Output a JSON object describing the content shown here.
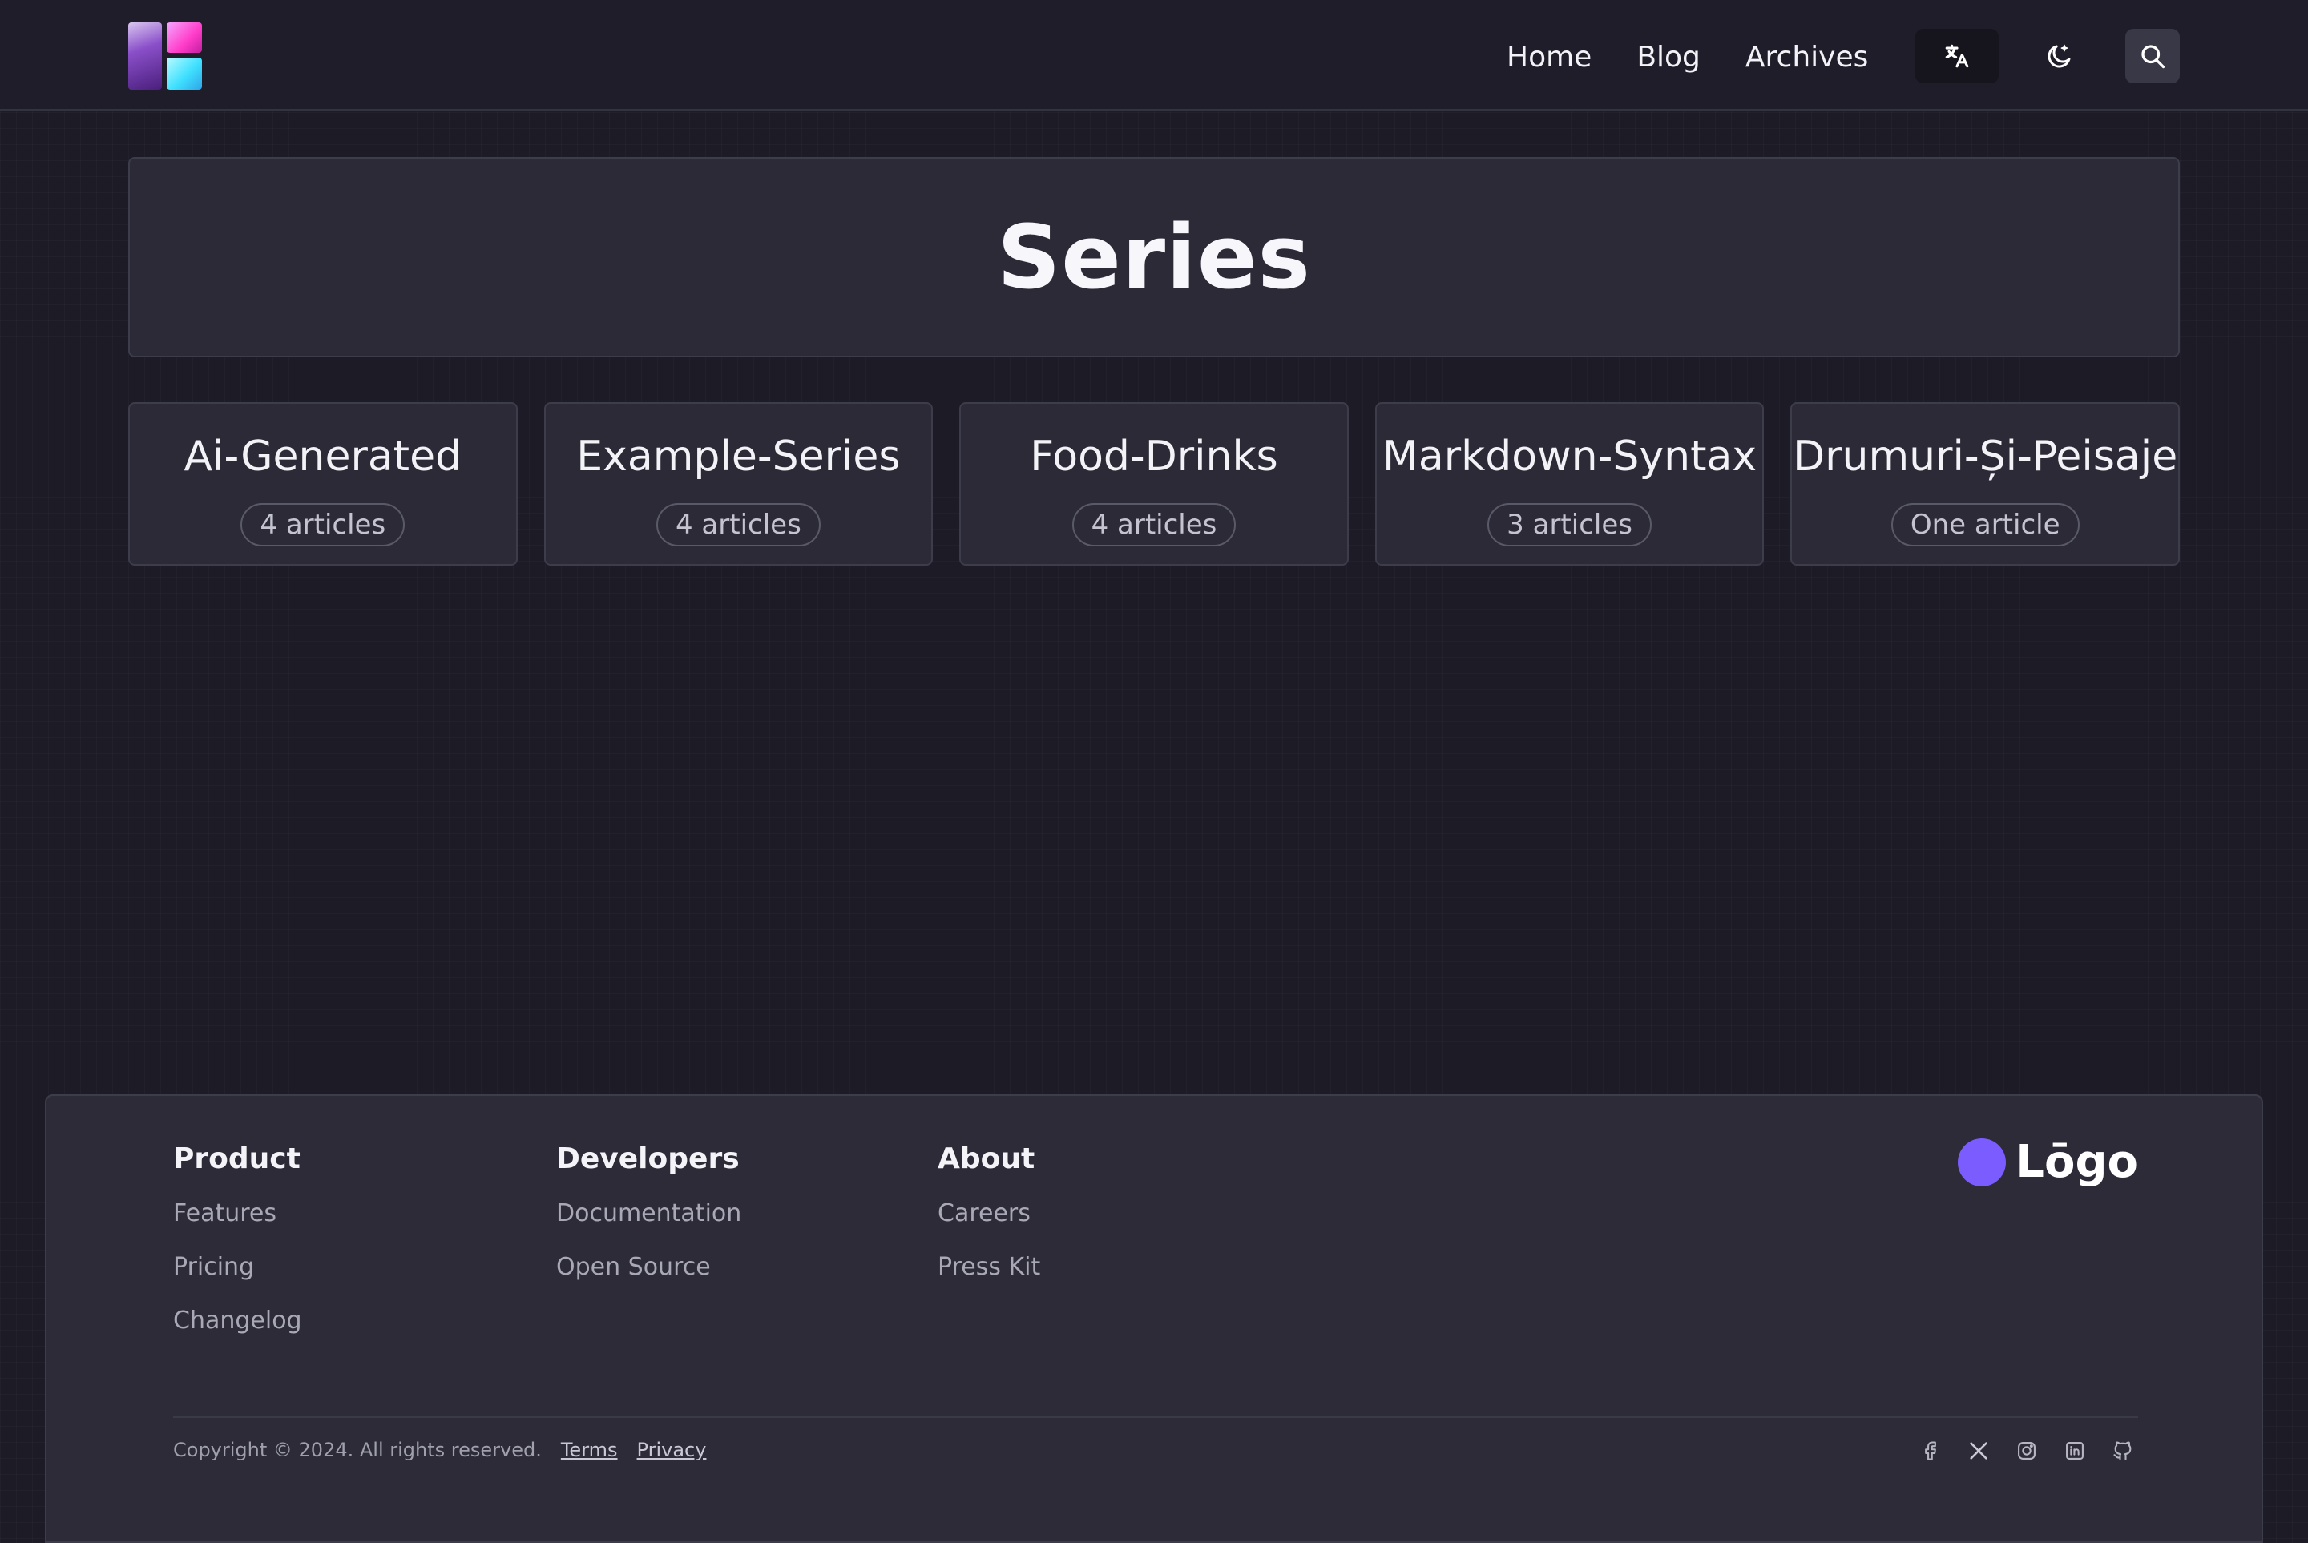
{
  "header": {
    "nav": [
      "Home",
      "Blog",
      "Archives"
    ],
    "icons": {
      "translate": "translate-icon",
      "theme": "moon-icon",
      "search": "search-icon"
    }
  },
  "hero": {
    "title": "Series"
  },
  "series": [
    {
      "name": "Ai-Generated",
      "count": "4 articles"
    },
    {
      "name": "Example-Series",
      "count": "4 articles"
    },
    {
      "name": "Food-Drinks",
      "count": "4 articles"
    },
    {
      "name": "Markdown-Syntax",
      "count": "3 articles"
    },
    {
      "name": "Drumuri-Și-Peisaje",
      "count": "One article"
    }
  ],
  "footer": {
    "columns": [
      {
        "title": "Product",
        "links": [
          "Features",
          "Pricing",
          "Changelog"
        ]
      },
      {
        "title": "Developers",
        "links": [
          "Documentation",
          "Open Source"
        ]
      },
      {
        "title": "About",
        "links": [
          "Careers",
          "Press Kit"
        ]
      }
    ],
    "brand": "Lōgo",
    "copyright": "Copyright © 2024. All rights reserved.",
    "terms": "Terms",
    "privacy": "Privacy",
    "socials": [
      "facebook-icon",
      "x-icon",
      "instagram-icon",
      "linkedin-icon",
      "github-icon"
    ]
  },
  "colors": {
    "background": "#1c1b26",
    "card": "#2b2a36",
    "brand_dot": "#7b5cff"
  }
}
